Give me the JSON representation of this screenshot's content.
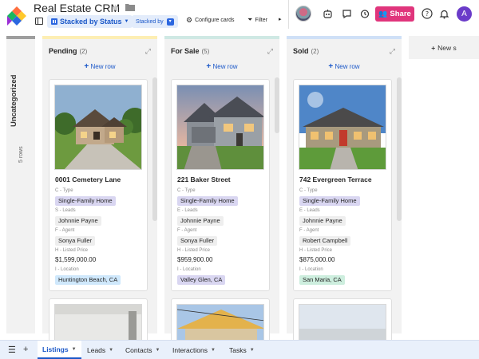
{
  "app": {
    "title": "Real Estate CRM",
    "brand_colors": [
      "#ff6f3f",
      "#ffc82c",
      "#18b760",
      "#2c67e0",
      "#9b2fd6"
    ]
  },
  "toolbar": {
    "view_label": "Stacked by Status",
    "stacked_by_label": "Stacked by",
    "configure_label": "Configure cards",
    "filter_label": "Filter",
    "more_label": "▸"
  },
  "header_right": {
    "share_label": "Share",
    "user_initial": "A",
    "share_color": "#e0357c"
  },
  "uncategorized": {
    "name": "Uncategorized",
    "count_label": "5 rows"
  },
  "columns": [
    {
      "name": "Pending",
      "count": "(2)",
      "color": "#fdeeb3",
      "new_row_label": "New row",
      "cards": [
        {
          "address": "0001 Cemetery Lane",
          "type_label": "C - Type",
          "type": "Single-Family Home",
          "leads_label": "S - Leads",
          "leads": "Johnnie Payne",
          "agent_label": "F - Agent",
          "agent": "Sonya Fuller",
          "price_label": "H - Listed Price",
          "price": "$1,599,000.00",
          "location_label": "I - Location",
          "location": "Huntington Beach, CA",
          "location_color": "#cfe8fc"
        }
      ]
    },
    {
      "name": "For Sale",
      "count": "(5)",
      "color": "#cfe9e4",
      "new_row_label": "New row",
      "cards": [
        {
          "address": "221 Baker Street",
          "type_label": "C - Type",
          "type": "Single-Family Home",
          "leads_label": "E - Leads",
          "leads": "Johnnie Payne",
          "agent_label": "F - Agent",
          "agent": "Sonya Fuller",
          "price_label": "H - Listed Price",
          "price": "$959,900.00",
          "location_label": "I - Location",
          "location": "Valley Glen, CA",
          "location_color": "#d9d6f1"
        }
      ]
    },
    {
      "name": "Sold",
      "count": "(2)",
      "color": "#cfe0f7",
      "new_row_label": "New row",
      "cards": [
        {
          "address": "742 Evergreen Terrace",
          "type_label": "C - Type",
          "type": "Single-Family Home",
          "leads_label": "E - Leads",
          "leads": "Johnnie Payne",
          "agent_label": "F - Agent",
          "agent": "Robert Campbell",
          "price_label": "H - Listed Price",
          "price": "$875,000.00",
          "location_label": "I - Location",
          "location": "San Maria, CA",
          "location_color": "#cdeede"
        }
      ]
    }
  ],
  "type_chip_color": "#d9d6f1",
  "new_section_label": "New s",
  "tabs": [
    {
      "label": "Listings",
      "active": true
    },
    {
      "label": "Leads",
      "active": false
    },
    {
      "label": "Contacts",
      "active": false
    },
    {
      "label": "Interactions",
      "active": false
    },
    {
      "label": "Tasks",
      "active": false
    }
  ]
}
